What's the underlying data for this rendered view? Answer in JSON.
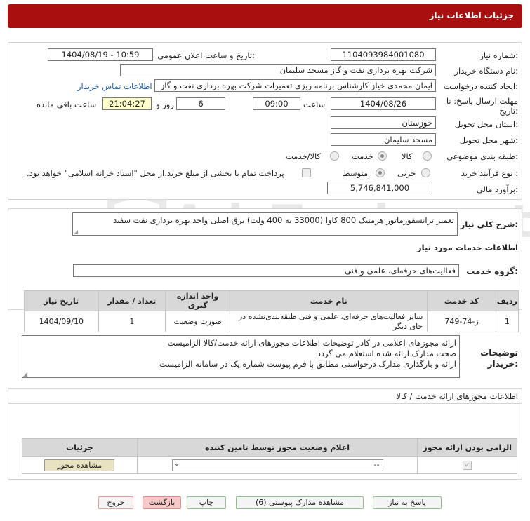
{
  "header": {
    "title": "جزئیات اطلاعات نیاز"
  },
  "form": {
    "need_number_label": "شماره نیاز:",
    "need_number": "1104093984001080",
    "announce_label": "تاریخ و ساعت اعلان عمومی:",
    "announce_value": "1404/08/19 - 10:59",
    "buyer_org_label": "نام دستگاه خریدار:",
    "buyer_org": "شرکت بهره برداری نفت و گاز مسجد سلیمان",
    "creator_label": "ایجاد کننده درخواست:",
    "creator": "ایمان محمدی خیاز کارشناس برنامه ریزی تعمیرات شرکت بهره برداری نفت و گاز",
    "contact_link": "اطلاعات تماس خریدار",
    "deadline_label": "مهلت ارسال پاسخ: تا",
    "deadline_label2": "تاریخ:",
    "deadline_date": "1404/08/26",
    "time_label": "ساعت",
    "deadline_time": "09:00",
    "days_value": "6",
    "days_label": "روز و",
    "remaining_time": "21:04:27",
    "remaining_label": "ساعت باقی مانده",
    "province_label": "استان محل تحویل:",
    "province": "خوزستان",
    "city_label": "شهر محل تحویل:",
    "city": "مسجد سلیمان",
    "category_label": "طبقه بندی موضوعی:",
    "category_options": [
      "کالا",
      "خدمت",
      "کالا/خدمت"
    ],
    "category_selected": "خدمت",
    "process_label": "نوع فرآیند خرید :",
    "process_options": [
      "جزیی",
      "متوسط"
    ],
    "process_selected": "متوسط",
    "payment_note": "پرداخت تمام یا بخشی از مبلغ خرید،از محل \"اسناد خزانه اسلامی\" خواهد بود.",
    "budget_label": "برآورد مالی:",
    "budget": "5,746,841,000"
  },
  "general": {
    "summary_label": "شرح کلی نیاز:",
    "summary": "تعمیر ترانسفورماتور هرمتیک 800 کاوا (33000 به 400 ولت) برق اصلی واحد بهره برداری نفت سفید",
    "services_title": "اطلاعات خدمات مورد نیاز",
    "service_group_label": "گروه خدمت:",
    "service_group": "فعالیت‌های حرفه‌ای، علمی و فنی"
  },
  "items_table": {
    "headers": [
      "ردیف",
      "کد خدمت",
      "نام خدمت",
      "واحد اندازه گیری",
      "تعداد / مقدار",
      "تاریخ نیاز"
    ],
    "rows": [
      [
        "1",
        "ز-74-749",
        "سایر فعالیت‌های حرفه‌ای، علمی و فنی طبقه‌بندی‌نشده در جای دیگر",
        "صورت وضعیت",
        "1",
        "1404/09/10"
      ]
    ]
  },
  "buyer_notes": {
    "label_1": "توضیحات",
    "label_2": "خریدار:",
    "lines": [
      "ارائه مجوزهای اعلامی در کادر توضیحات اطلاعات مجوزهای ارائه خدمت/کالا الزامیست",
      "صحت مدارک ارائه شده استعلام می گردد",
      "ارائه و بارگذاری مدارک درخواستی مطابق با فرم پیوست شماره یک در سامانه الزامیست"
    ]
  },
  "licenses": {
    "title": "اطلاعات مجوزهای ارائه خدمت / کالا",
    "headers": [
      "الزامی بودن ارائه مجوز",
      "اعلام وضعیت مجوز توسط تامین کننده",
      "جزئیات"
    ],
    "select_value": "--",
    "view_button": "مشاهده مجوز"
  },
  "buttons": {
    "reply": "پاسخ به نیاز",
    "attachments": "مشاهده مدارک پیوستی (6)",
    "print": "چاپ",
    "back": "بازگشت",
    "exit": "خروج"
  },
  "watermark": {
    "text": "AriaTender.net"
  },
  "colors": {
    "header_bg": "#a80f0f",
    "link": "#1a5fb4",
    "remaining_bg": "#ffffcc",
    "table_header_bg": "#d8d8d8"
  }
}
